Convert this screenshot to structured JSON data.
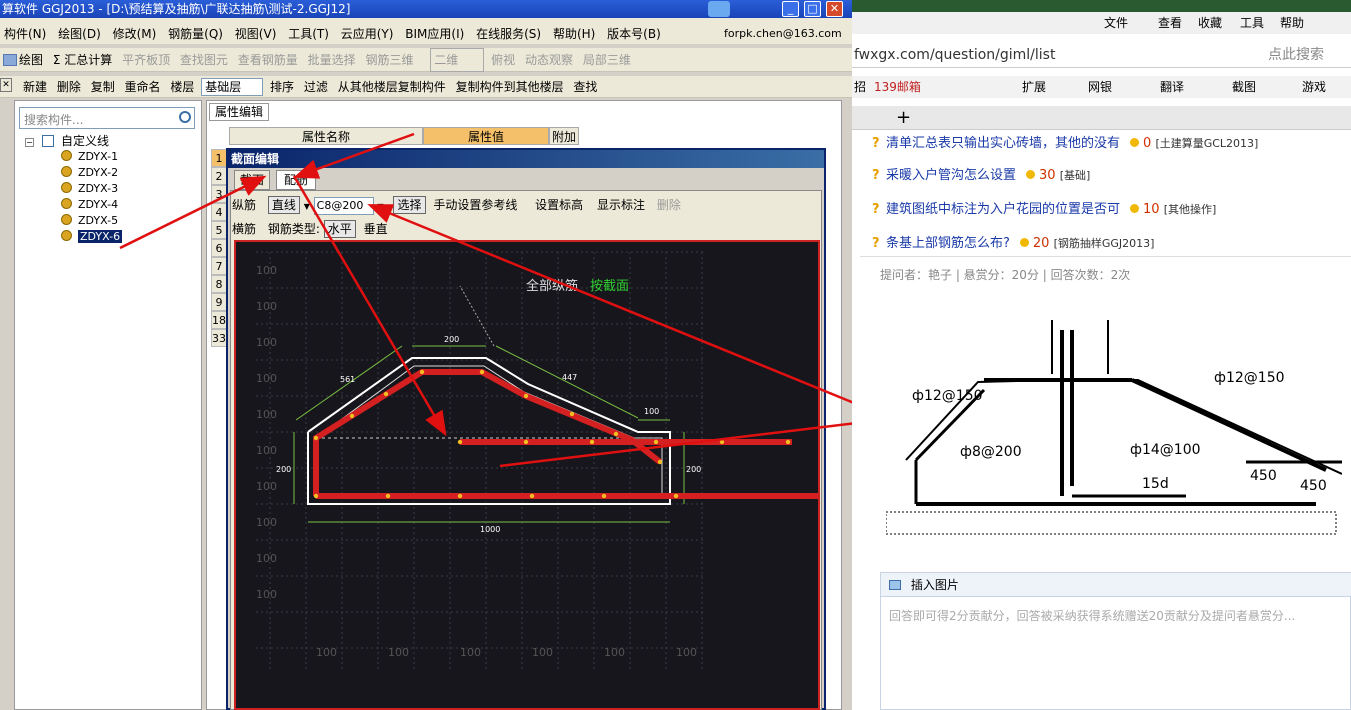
{
  "app": {
    "title": "算软件 GGJ2013 - [D:\\预结算及抽筋\\广联达抽筋\\测试-2.GGJ12]",
    "menu": [
      "构件(N)",
      "绘图(D)",
      "修改(M)",
      "钢筋量(Q)",
      "视图(V)",
      "工具(T)",
      "云应用(Y)",
      "BIM应用(I)",
      "在线服务(S)",
      "帮助(H)",
      "版本号(B)"
    ],
    "user": "forpk.chen@163.com",
    "toolbar1": [
      "绘图",
      "Σ 汇总计算",
      "平齐板顶",
      "查找图元",
      "查看钢筋量",
      "批量选择",
      "钢筋三维",
      "二维",
      "俯视",
      "动态观察",
      "局部三维"
    ],
    "toolbar2": [
      "新建",
      "删除",
      "复制",
      "重命名",
      "楼层",
      "基础层",
      "排序",
      "过滤",
      "从其他楼层复制构件",
      "复制构件到其他楼层",
      "查找"
    ],
    "search_placeholder": "搜索构件...",
    "tree_root": "自定义线",
    "tree_items": [
      "ZDYX-1",
      "ZDYX-2",
      "ZDYX-3",
      "ZDYX-4",
      "ZDYX-5",
      "ZDYX-6"
    ],
    "prop_tab": "属性编辑",
    "prop_headers": [
      "属性名称",
      "属性值",
      "附加"
    ],
    "row_numbers": [
      "1",
      "2",
      "3",
      "4",
      "5",
      "6",
      "7",
      "8",
      "9",
      "18",
      "33"
    ]
  },
  "dialog": {
    "title": "截面编辑",
    "tabs": [
      "截面",
      "配筋"
    ],
    "row1_label": "纵筋",
    "row1_mode": "直线",
    "row1_value": "C8@200",
    "row1_buttons": [
      "选择",
      "手动设置参考线",
      "设置标高",
      "显示标注",
      "删除"
    ],
    "row2_label": "横筋",
    "row2_type_label": "钢筋类型:",
    "row2_options": [
      "水平",
      "垂直"
    ],
    "canvas_label_white": "全部纵筋",
    "canvas_label_green": "按截面",
    "dims": [
      "200",
      "561",
      "447",
      "100",
      "200",
      "200",
      "1000"
    ],
    "grid_labels": [
      "100",
      "100",
      "100",
      "100",
      "100",
      "100",
      "100",
      "100",
      "100",
      "100",
      "100",
      "100",
      "100",
      "100",
      "100",
      "100"
    ],
    "colors": {
      "accent_red": "#d42020",
      "canvas": "#16161c",
      "dim_green": "#7ac043"
    }
  },
  "browser": {
    "menu": [
      "文件",
      "查看",
      "收藏",
      "工具",
      "帮助"
    ],
    "address": "fwxgx.com/question/giml/list",
    "search_hint": "点此搜索",
    "favorites": [
      "招",
      "139邮箱",
      "扩展",
      "网银",
      "翻译",
      "截图",
      "游戏"
    ],
    "questions": [
      {
        "title": "清单汇总表只输出实心砖墙，其他的没有",
        "score": "0",
        "tag": "[土建算量GCL2013]"
      },
      {
        "title": "采暖入户管沟怎么设置",
        "score": "30",
        "tag": "[基础]"
      },
      {
        "title": "建筑图纸中标注为入户花园的位置是否可",
        "score": "10",
        "tag": "[其他操作]"
      },
      {
        "title": "条基上部钢筋怎么布?",
        "score": "20",
        "tag": "[钢筋抽样GGJ2013]"
      }
    ],
    "meta": "提问者：艳子  |  悬赏分：20分  |  回答次数：2次",
    "drawing_labels": [
      "ф12@150",
      "ф12@150",
      "ф8@200",
      "ф14@100",
      "15d",
      "450",
      "450"
    ],
    "insert_image": "插入图片",
    "answer_placeholder": "回答即可得2分贡献分，回答被采纳获得系统赠送20贡献分及提问者悬赏分..."
  }
}
